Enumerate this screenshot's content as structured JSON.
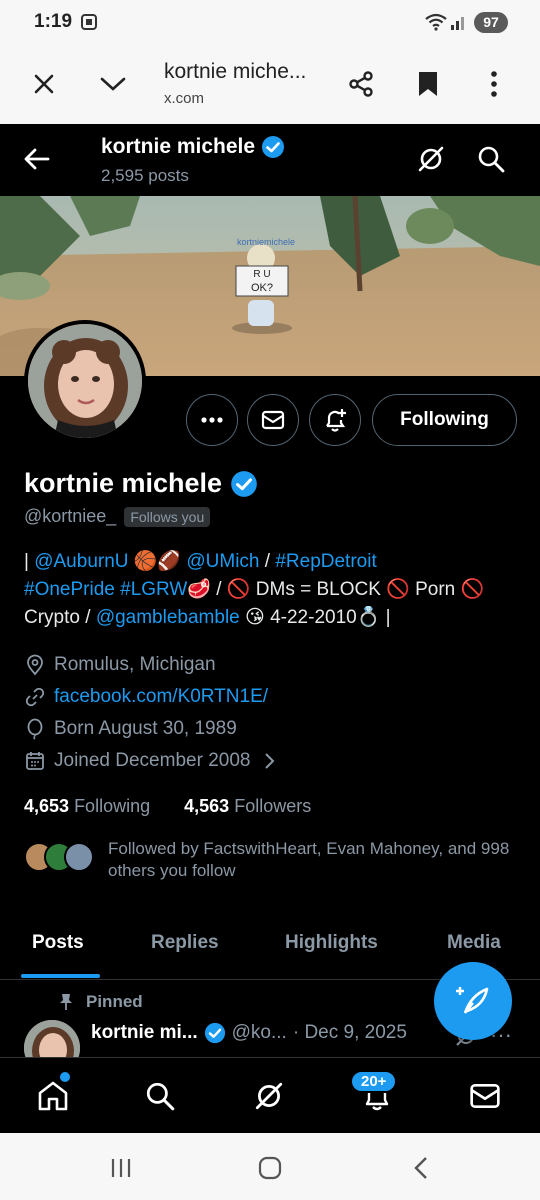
{
  "status_bar": {
    "time": "1:19",
    "battery": "97"
  },
  "browser": {
    "title": "kortnie miche...",
    "url": "x.com"
  },
  "header": {
    "name": "kortnie michele",
    "posts": "2,595 posts"
  },
  "banner": {
    "watermark": "kortniemichele",
    "sign": "R U OK?"
  },
  "profile": {
    "name": "kortnie michele",
    "handle": "@kortniee_",
    "follows_you": "Follows you",
    "following_button": "Following",
    "bio": {
      "p1": "| ",
      "auburn": "@AuburnU",
      "p2": " 🏀🏈 ",
      "umich": "@UMich",
      "p3": " / ",
      "detroit": "#RepDetroit",
      "onepride": "#OnePride",
      "p4": " ",
      "lgrw": "#LGRW",
      "p5": "🥩 / 🚫 DMs = BLOCK 🚫 Porn 🚫 Crypto / ",
      "gamble": "@gamblebamble",
      "p6": " 😘 4-22-2010💍 |"
    },
    "location": "Romulus, Michigan",
    "website": "facebook.com/K0RTN1E/",
    "born": "Born August 30, 1989",
    "joined": "Joined December 2008",
    "following_count": "4,653",
    "following_label": "Following",
    "followers_count": "4,563",
    "followers_label": "Followers",
    "followed_by": "Followed by FactswithHeart, Evan Mahoney, and 998 others you follow"
  },
  "tabs": [
    "Posts",
    "Replies",
    "Highlights",
    "Media"
  ],
  "pinned_post": {
    "pinned_label": "Pinned",
    "name": "kortnie mi...",
    "handle": "@ko...",
    "date": "· Dec 9, 2025",
    "more": "···"
  },
  "bottom_nav": {
    "notifications_badge": "20+"
  },
  "colors": {
    "accent": "#1d9bf0",
    "background": "#000000",
    "muted": "#8b98a5"
  }
}
